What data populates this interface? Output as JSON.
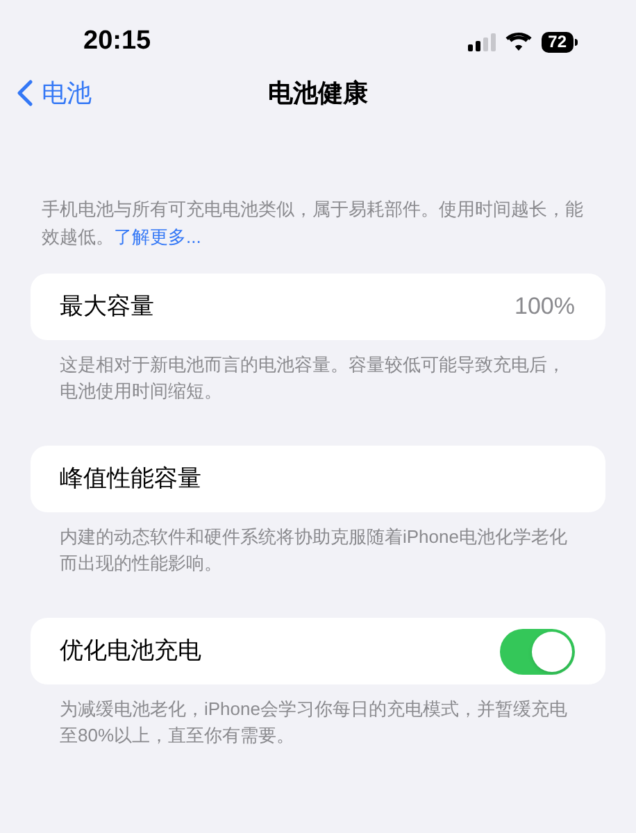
{
  "status_bar": {
    "time": "20:15",
    "battery": "72"
  },
  "nav": {
    "back": "电池",
    "title": "电池健康"
  },
  "intro": {
    "text": "手机电池与所有可充电电池类似，属于易耗部件。使用时间越长，能效越低。",
    "link": "了解更多..."
  },
  "sections": [
    {
      "kind": "value",
      "label": "最大容量",
      "value": "100%",
      "footer": "这是相对于新电池而言的电池容量。容量较低可能导致充电后，电池使用时间缩短。"
    },
    {
      "kind": "plain",
      "label": "峰值性能容量",
      "footer": "内建的动态软件和硬件系统将协助克服随着iPhone电池化学老化而出现的性能影响。"
    },
    {
      "kind": "toggle",
      "label": "优化电池充电",
      "on": true,
      "footer": "为减缓电池老化，iPhone会学习你每日的充电模式，并暂缓充电至80%以上，直至你有需要。"
    }
  ]
}
